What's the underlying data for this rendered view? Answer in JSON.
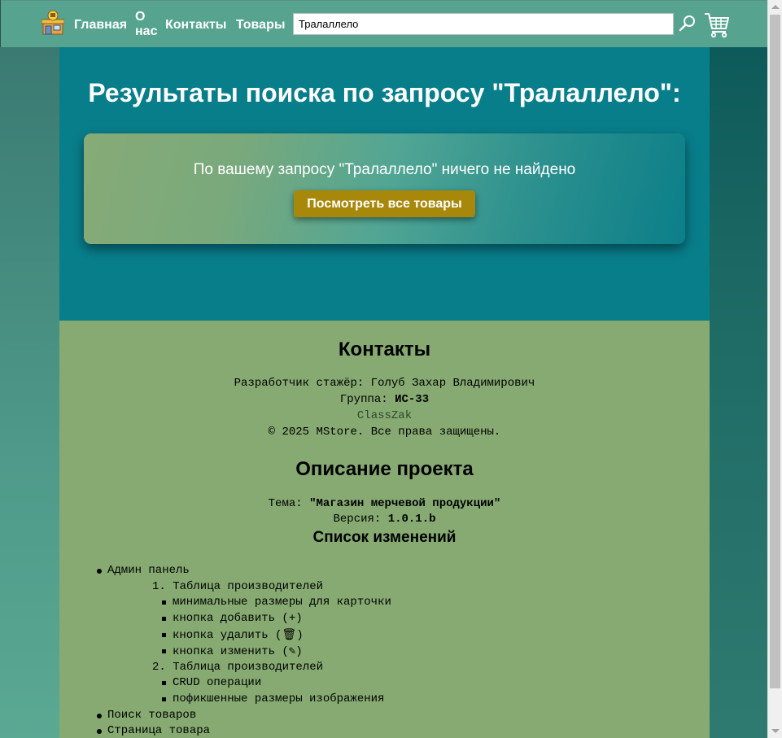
{
  "header": {
    "nav": {
      "home": "Главная",
      "about_line1": "О",
      "about_line2": "нас",
      "contacts": "Контакты",
      "goods": "Товары"
    },
    "search": {
      "value": "Тралаллело"
    }
  },
  "main": {
    "title": "Результаты поиска по запросу \"Тралаллело\":",
    "message": "По вашему запросу \"Тралаллело\" ничего не найдено",
    "all_button": "Посмотреть все товары"
  },
  "footer": {
    "contacts_heading": "Контакты",
    "developer": "Разработчик стажёр: Голуб Захар Владимирович",
    "group_label": "Группа: ",
    "group_value": "ИС-33",
    "github": "ClassZak",
    "copyright": "© 2025 MStore. Все права защищены.",
    "desc_heading": "Описание проекта",
    "theme_label": "Тема: ",
    "theme_value": "\"Магазин мерчевой продукции\"",
    "version_label": "Версия: ",
    "version_value": "1.0.1.b",
    "changes_heading": "Список изменений",
    "changes": {
      "admin": "Админ панель",
      "sub1": "1. Таблица производителей",
      "sub1_items": [
        "минимальные размеры для карточки",
        "кнопка добавить (+)",
        "кнопка удалить (🗑)",
        "кнопка изменить (✎)"
      ],
      "sub2": "2. Таблица производителей",
      "sub2_items": [
        "CRUD операции",
        "пофикшенные размеры изображения"
      ],
      "search": "Поиск товаров",
      "product_page": "Страница товара"
    }
  },
  "colors": {
    "header_bg": "#56a48f",
    "main_bg": "#087e8b",
    "footer_bg": "#86aa72",
    "button_bg": "#a8880a"
  },
  "icons": [
    "shop-logo-icon",
    "search-icon",
    "cart-icon"
  ]
}
